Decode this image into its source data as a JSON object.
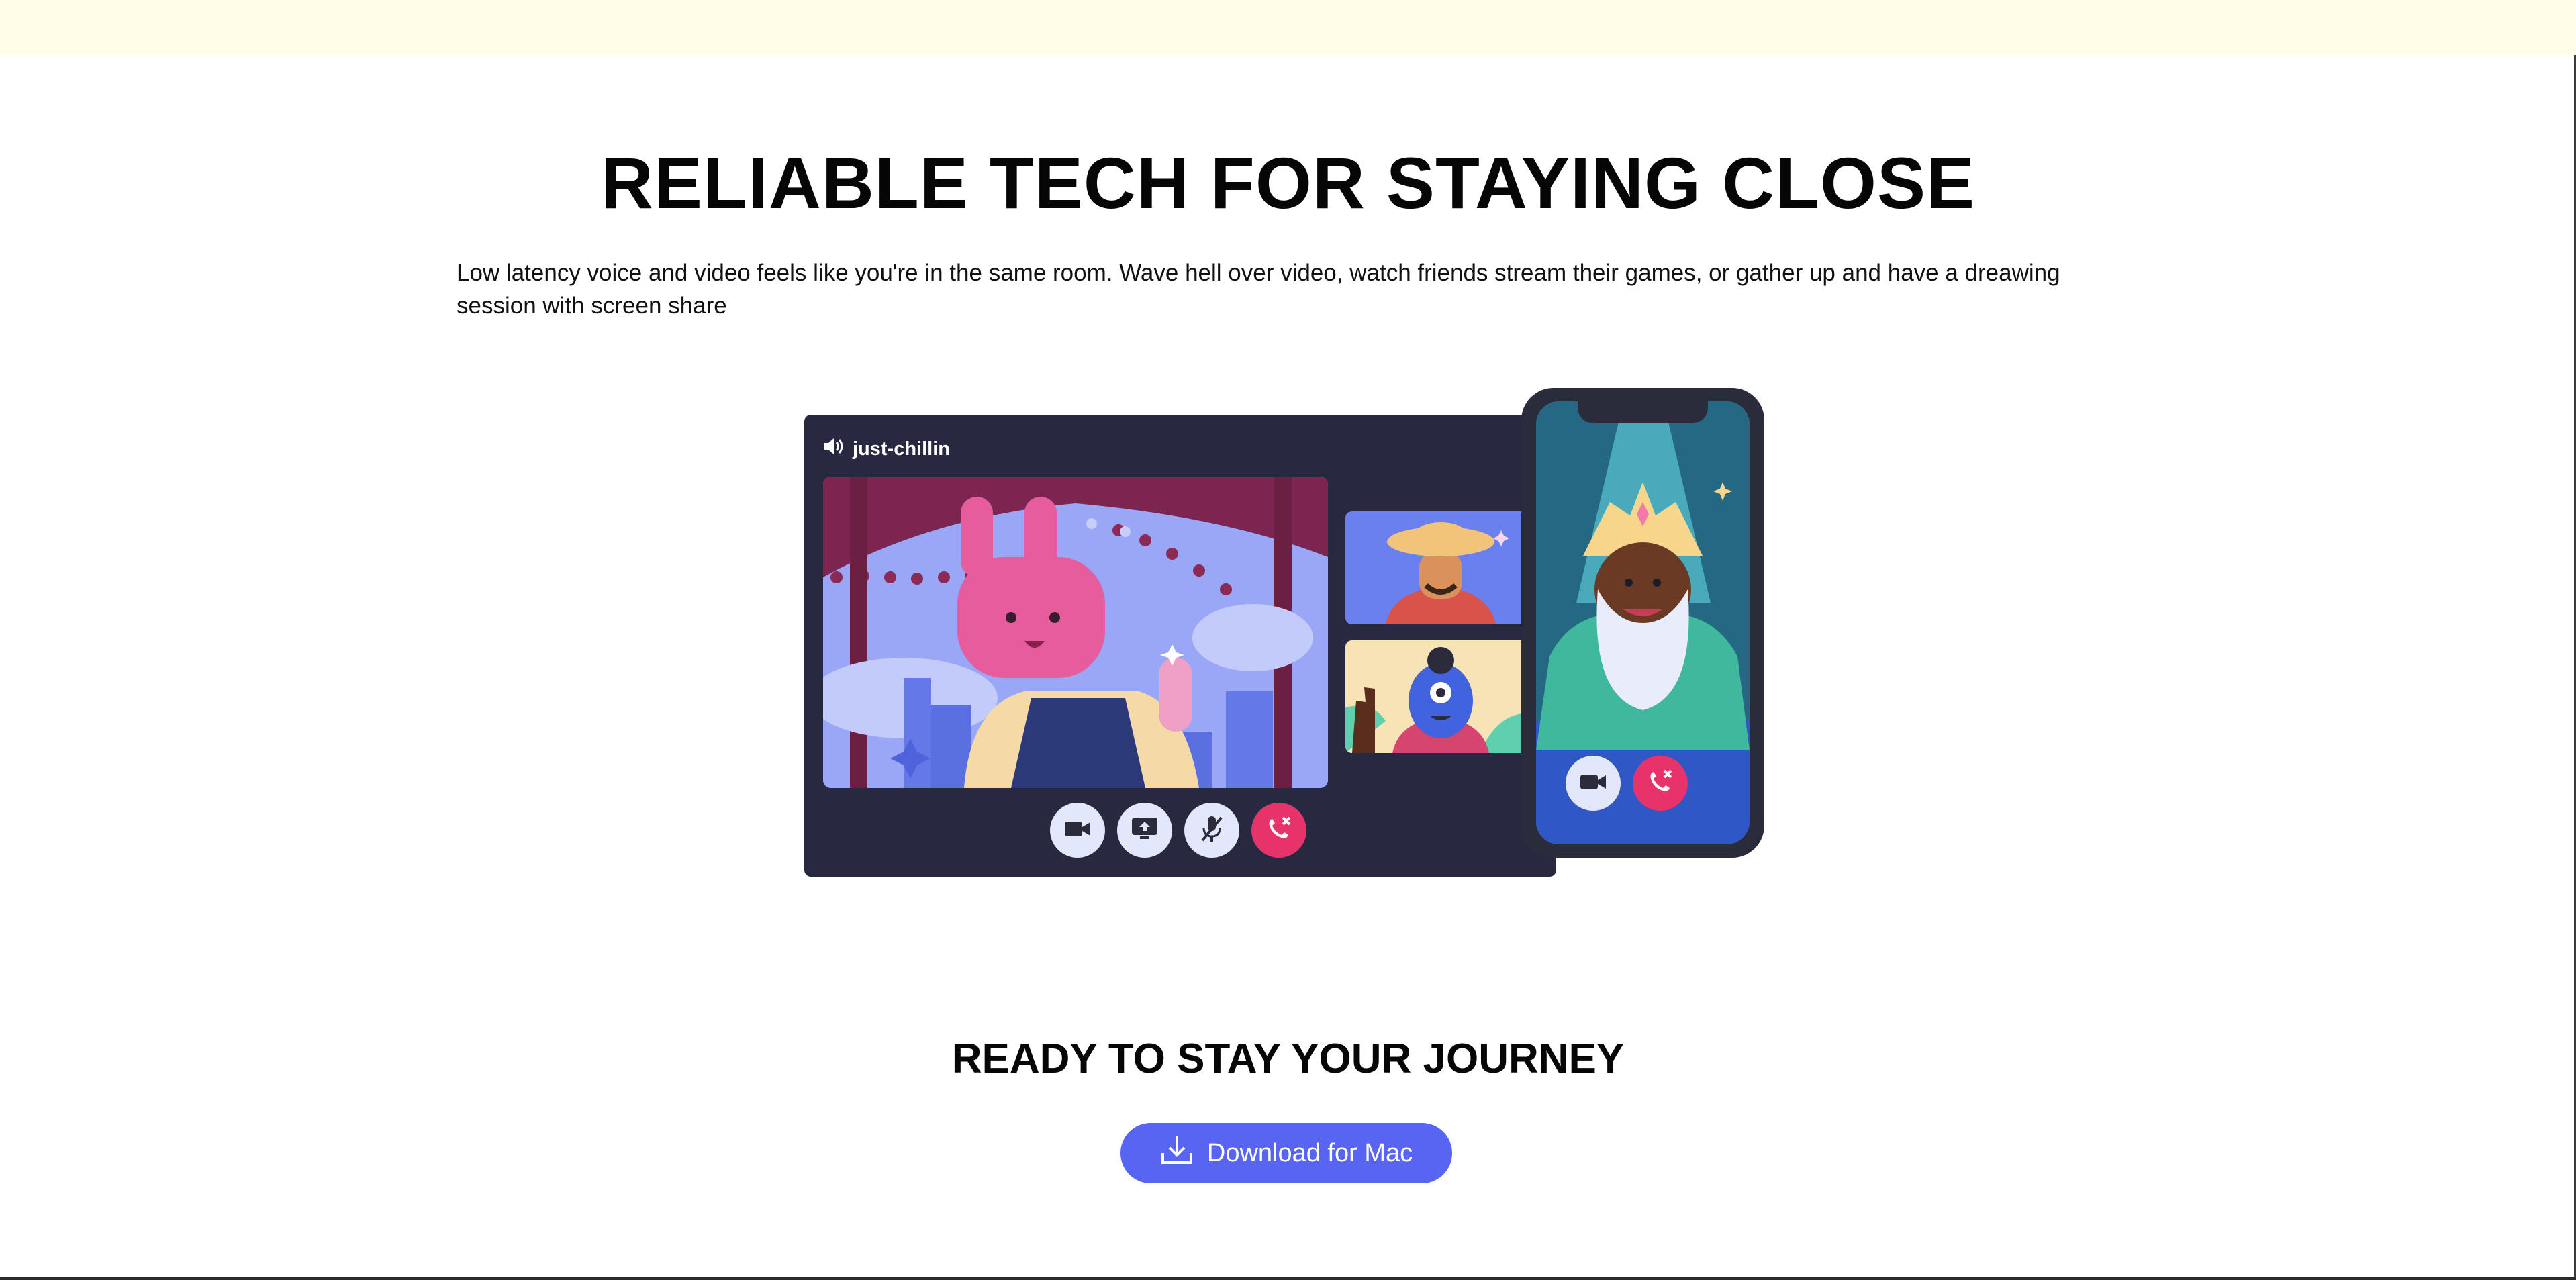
{
  "hero": {
    "title": "RELIABLE TECH FOR STAYING CLOSE",
    "description": "Low latency voice and video feels like you're in the same room. Wave hell over video, watch friends stream their games, or gather up and have a dreawing session with screen share"
  },
  "call_window": {
    "channel_name": "just-chillin",
    "channel_icon": "speaker-icon",
    "controls": [
      {
        "icon": "video-camera-icon"
      },
      {
        "icon": "screen-share-icon"
      },
      {
        "icon": "mute-microphone-icon"
      },
      {
        "icon": "end-call-icon"
      }
    ]
  },
  "phone": {
    "controls": [
      {
        "icon": "video-camera-icon"
      },
      {
        "icon": "end-call-icon"
      }
    ]
  },
  "cta": {
    "title": "READY TO STAY YOUR JOURNEY",
    "button_label": "Download for Mac",
    "button_icon": "download-icon"
  },
  "colors": {
    "accent": "#5865f2",
    "banner": "#fffde8",
    "call_bg": "#292841",
    "end_call": "#e8336a"
  }
}
